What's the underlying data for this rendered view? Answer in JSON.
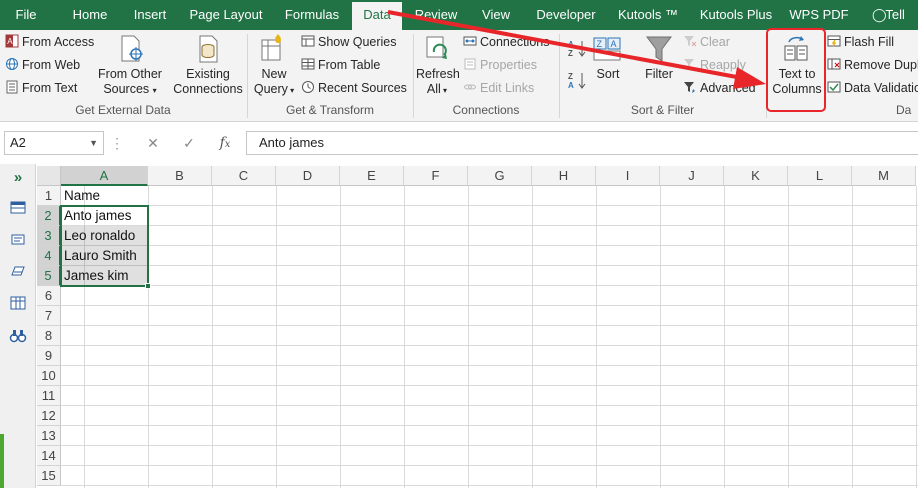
{
  "tabs": [
    {
      "label": "File"
    },
    {
      "label": "Home"
    },
    {
      "label": "Insert"
    },
    {
      "label": "Page Layout"
    },
    {
      "label": "Formulas"
    },
    {
      "label": "Data"
    },
    {
      "label": "Review"
    },
    {
      "label": "View"
    },
    {
      "label": "Developer"
    },
    {
      "label": "Kutools ™"
    },
    {
      "label": "Kutools Plus"
    },
    {
      "label": "WPS PDF"
    }
  ],
  "tell_me": "Tell m",
  "ribbon": {
    "get_external": {
      "from_access": "From Access",
      "from_web": "From Web",
      "from_text": "From Text",
      "from_other_1": "From Other",
      "from_other_2": "Sources",
      "existing_1": "Existing",
      "existing_2": "Connections",
      "label": "Get External Data"
    },
    "get_transform": {
      "new_query_1": "New",
      "new_query_2": "Query",
      "show_queries": "Show Queries",
      "from_table": "From Table",
      "recent_sources": "Recent Sources",
      "label": "Get & Transform"
    },
    "connections": {
      "refresh_1": "Refresh",
      "refresh_2": "All",
      "connections": "Connections",
      "properties": "Properties",
      "edit_links": "Edit Links",
      "label": "Connections"
    },
    "sort_filter": {
      "sort": "Sort",
      "filter": "Filter",
      "clear": "Clear",
      "reapply": "Reapply",
      "advanced": "Advanced",
      "label": "Sort & Filter"
    },
    "data_tools": {
      "text_to_1": "Text to",
      "text_to_2": "Columns",
      "flash_fill": "Flash Fill",
      "remove_dup": "Remove Dupl",
      "data_validation": "Data Validatio",
      "label": "Da"
    }
  },
  "formula_bar": {
    "name_box": "A2",
    "formula": "Anto james"
  },
  "grid": {
    "columns": [
      "A",
      "B",
      "C",
      "D",
      "E",
      "F",
      "G",
      "H",
      "I",
      "J",
      "K",
      "L",
      "M"
    ],
    "rows": [
      "1",
      "2",
      "3",
      "4",
      "5",
      "6",
      "7",
      "8",
      "9",
      "10",
      "11",
      "12",
      "13",
      "14",
      "15"
    ],
    "cells": {
      "A1": "Name",
      "A2": "Anto james",
      "A3": "Leo ronaldo",
      "A4": "Lauro Smith",
      "A5": "James kim"
    }
  },
  "colors": {
    "accent": "#217346",
    "annotation": "#e8262a"
  }
}
